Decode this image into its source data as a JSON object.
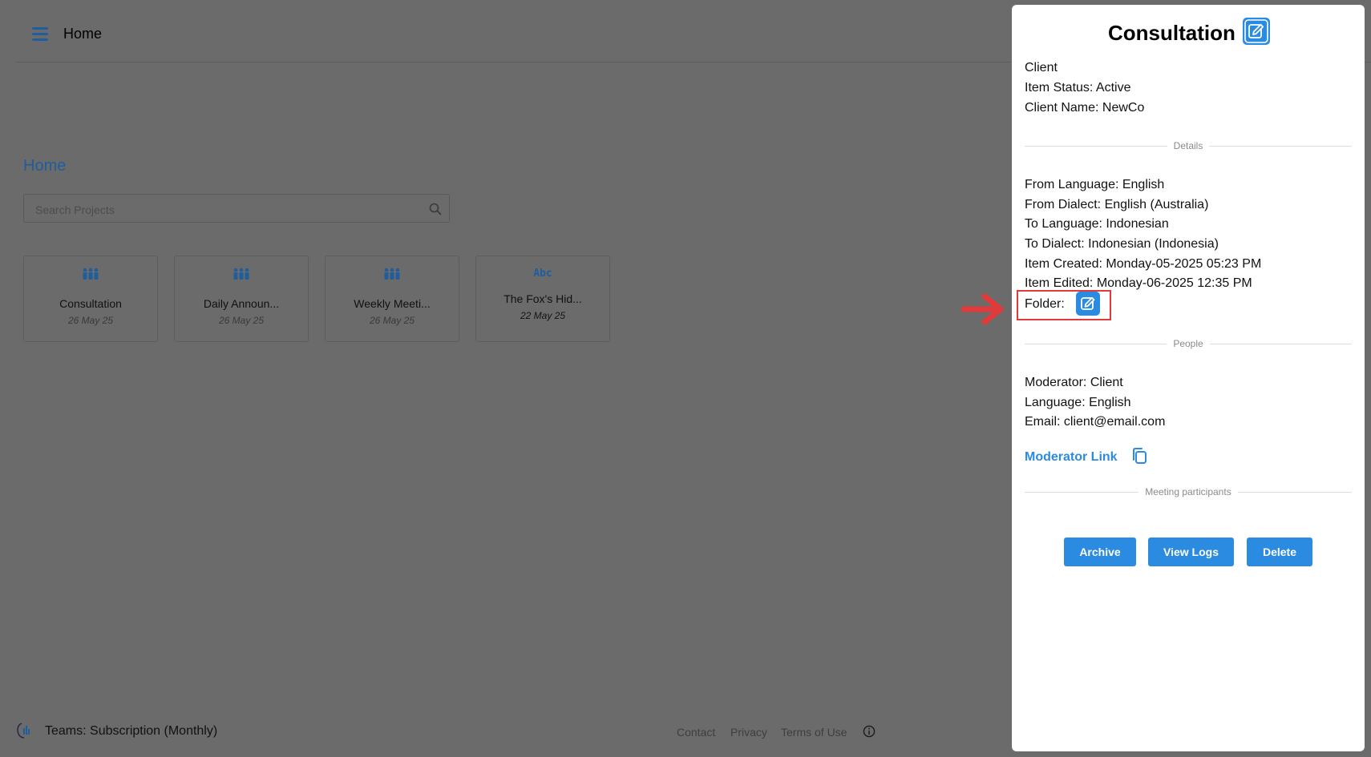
{
  "header": {
    "title": "Home"
  },
  "main": {
    "section_title": "Home",
    "search": {
      "placeholder": "Search Projects",
      "value": ""
    },
    "projects": [
      {
        "name": "Consultation",
        "date": "26 May 25",
        "icon": "people-group-icon"
      },
      {
        "name": "Daily Announ...",
        "date": "26 May 25",
        "icon": "people-group-icon"
      },
      {
        "name": "Weekly Meeti...",
        "date": "26 May 25",
        "icon": "people-group-icon"
      },
      {
        "name": "The Fox's Hid...",
        "date": "22 May 25",
        "icon": "abc-text-icon",
        "icon_text": "Abc"
      }
    ]
  },
  "footer": {
    "plan": "Teams: Subscription (Monthly)",
    "links": [
      "Contact",
      "Privacy",
      "Terms of Use"
    ]
  },
  "panel": {
    "title": "Consultation",
    "client_lines": [
      "Client",
      "Item Status: Active",
      "Client Name: NewCo"
    ],
    "details_label": "Details",
    "details": [
      "From Language: English",
      "From Dialect: English (Australia)",
      "To Language: Indonesian",
      "To Dialect: Indonesian (Indonesia)",
      "Item Created: Monday-05-2025 05:23 PM",
      "Item Edited: Monday-06-2025 12:35 PM"
    ],
    "folder_label": "Folder:",
    "people_label": "People",
    "people": [
      "Moderator: Client",
      "Language: English",
      "Email: client@email.com"
    ],
    "moderator_link": "Moderator Link",
    "participants_label": "Meeting participants",
    "buttons": {
      "archive": "Archive",
      "view_logs": "View Logs",
      "delete": "Delete"
    }
  },
  "colors": {
    "accent": "#2b8be0",
    "overlay": "#6b6b6b",
    "annotation": "#e23a3a",
    "link_dim": "#1f5e9c"
  }
}
